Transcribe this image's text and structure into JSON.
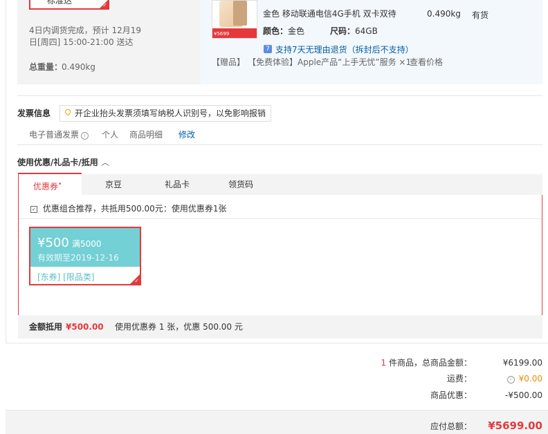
{
  "delivery": {
    "button_label": "标准达",
    "note_line1": "4日内调货完成，预计 12月19",
    "note_line2": "日[周四] 15:00-21:00 送达",
    "weight_label": "总重量：",
    "weight_value": "0.490kg"
  },
  "product": {
    "image_tag": "¥5699",
    "title_line": "金色 移动联通电信4G手机 双卡双待",
    "weight": "0.490kg",
    "stock": "有货",
    "color_label": "颜色：",
    "color_value": "金色",
    "size_label": "尺码：",
    "size_value": "64GB",
    "return_icon": "7",
    "return_policy": "支持7天无理由退货（拆封后不支持）",
    "gift_tag": "【赠品】",
    "gift_text": "【免费体验】Apple产品“上手无忧”服务 ×1",
    "gift_link": "查看价格"
  },
  "invoice": {
    "section_label": "发票信息",
    "tip": "开企业抬头发票须填写纳税人识别号，以免影响报销",
    "type": "电子普通发票",
    "title": "个人",
    "content": "商品明细",
    "edit_link": "修改"
  },
  "discount": {
    "section_label": "使用优惠/礼品卡/抵用",
    "tabs": [
      {
        "label": "优惠券",
        "badge": "•"
      },
      {
        "label": "京豆"
      },
      {
        "label": "礼品卡"
      },
      {
        "label": "领货码"
      }
    ],
    "combo_check_mark": "✓",
    "combo_text": "优惠组合推荐，共抵用500.00元：使用优惠券1张",
    "coupon": {
      "amount": "¥500",
      "condition": "满5000",
      "expiry": "有效期至2019-12-16",
      "tags": "[东券] [限品类]"
    },
    "summary_label": "金额抵用",
    "summary_amount": "¥500.00",
    "summary_text": "使用优惠券 1 张，优惠 500.00 元"
  },
  "totals": {
    "count": "1",
    "count_text": "件商品，总商品金额：",
    "goods_amount": "¥6199.00",
    "shipping_label": "运费：",
    "shipping_amount": "¥0.00",
    "discount_label": "商品优惠：",
    "discount_amount": "-¥500.00",
    "payable_label": "应付总额：",
    "payable_amount": "¥5699.00"
  }
}
